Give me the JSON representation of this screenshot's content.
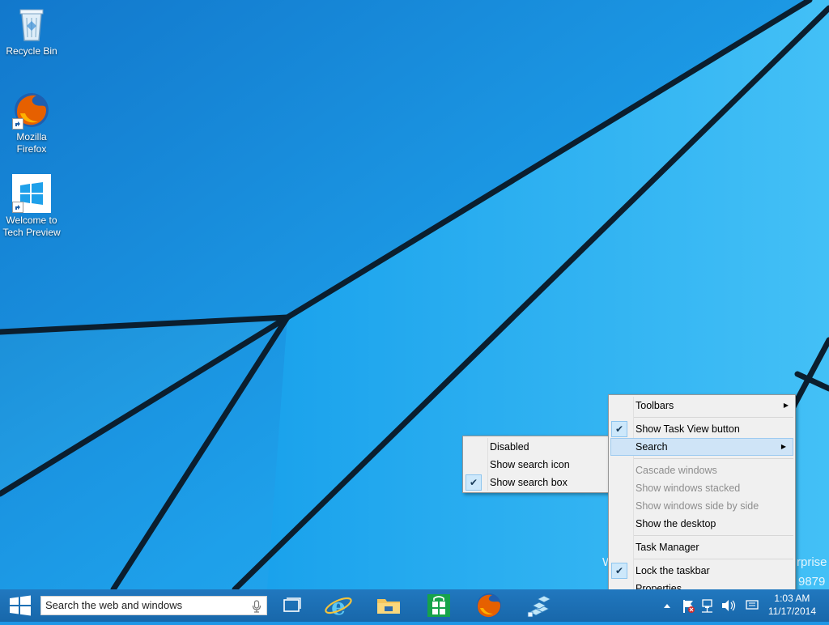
{
  "desktop": {
    "icons": [
      {
        "label": "Recycle Bin",
        "icon": "recycle-bin-icon"
      },
      {
        "label": "Mozilla\nFirefox",
        "icon": "firefox-icon"
      },
      {
        "label": "Welcome to\nTech Preview",
        "icon": "windows-logo-icon"
      }
    ],
    "watermark": {
      "line1_fragment": "W",
      "line1_end": "rprise",
      "line2_end": "9879"
    }
  },
  "context_menu": {
    "items": [
      {
        "label": "Toolbars",
        "submenu": true
      },
      {
        "label": "Show Task View button",
        "checked": true
      },
      {
        "label": "Search",
        "submenu": true,
        "highlighted": true
      },
      {
        "label": "Cascade windows",
        "disabled": true
      },
      {
        "label": "Show windows stacked",
        "disabled": true
      },
      {
        "label": "Show windows side by side",
        "disabled": true
      },
      {
        "label": "Show the desktop"
      },
      {
        "label": "Task Manager"
      },
      {
        "label": "Lock the taskbar",
        "checked": true
      },
      {
        "label": "Properties"
      }
    ]
  },
  "search_submenu": {
    "items": [
      {
        "label": "Disabled"
      },
      {
        "label": "Show search icon"
      },
      {
        "label": "Show search box",
        "checked": true
      }
    ]
  },
  "taskbar": {
    "search_placeholder": "Search the web and windows",
    "pinned": [
      "task-view-icon",
      "internet-explorer-icon",
      "file-explorer-icon",
      "store-icon",
      "firefox-icon",
      "settings-app-icon"
    ],
    "clock_time": "1:03 AM",
    "clock_date": "11/17/2014"
  },
  "colors": {
    "accent": "#1e96e6",
    "taskbar": "#1a6fb4",
    "menu_bg": "#f0f0f0",
    "highlight": "#cfe4f7"
  }
}
